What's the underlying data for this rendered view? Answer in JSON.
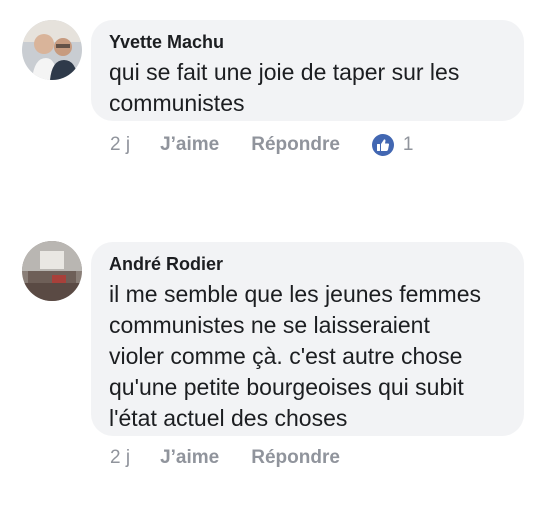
{
  "comments": [
    {
      "author": "Yvette Machu",
      "text_lines": [
        "qui se fait une joie de taper sur les",
        "communistes"
      ],
      "time": "2 j",
      "like_label": "J’aime",
      "reply_label": "Répondre",
      "reaction_count": "1",
      "reaction_icon": "thumbs-up-icon"
    },
    {
      "author": "André Rodier",
      "text_lines": [
        "il me semble que les jeunes femmes",
        "communistes ne se laisseraient",
        "violer comme çà. c'est autre chose",
        "qu'une petite bourgeoises qui subit",
        "l'état actuel des choses"
      ],
      "time": "2 j",
      "like_label": "J’aime",
      "reply_label": "Répondre"
    }
  ],
  "colors": {
    "bubble_bg": "#f2f3f5",
    "text": "#1c1e21",
    "meta": "#90949c",
    "like_blue": "#4267b2"
  }
}
